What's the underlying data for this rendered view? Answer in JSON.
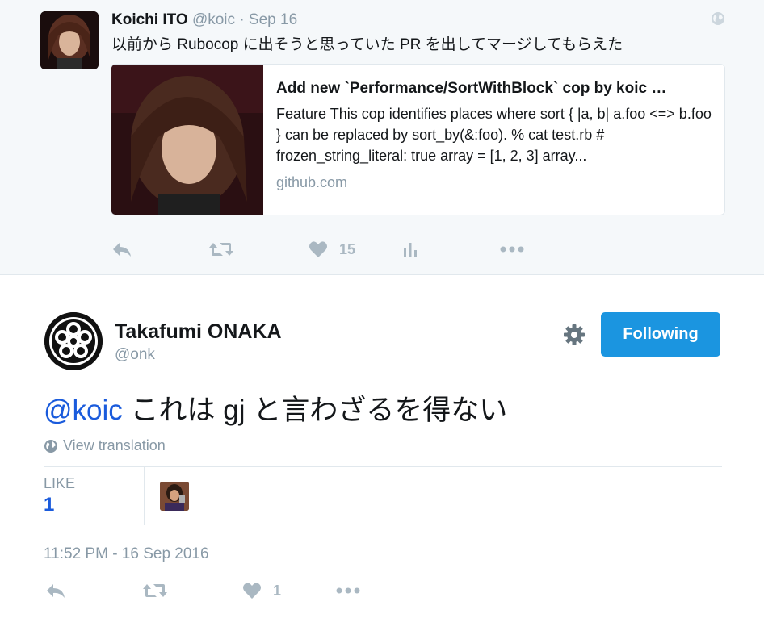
{
  "parent_tweet": {
    "name": "Koichi ITO",
    "handle": "@koic",
    "separator": "·",
    "date": "Sep 16",
    "text": "以前から Rubocop に出そうと思っていた PR を出してマージしてもらえた",
    "card": {
      "title": "Add new `Performance/SortWithBlock` cop by koic …",
      "description": "Feature This cop identifies places where sort { |a, b| a.foo <=> b.foo } can be replaced by sort_by(&:foo). % cat test.rb # frozen_string_literal: true array = [1, 2, 3] array...",
      "domain": "github.com"
    },
    "actions": {
      "reply_icon": "reply-icon",
      "retweet_icon": "retweet-icon",
      "like_icon": "heart-icon",
      "like_count": "15",
      "analytics_icon": "analytics-icon",
      "more_icon": "more-icon"
    }
  },
  "main_tweet": {
    "name": "Takafumi ONAKA",
    "handle": "@onk",
    "follow_label": "Following",
    "settings_icon": "gear-icon",
    "mention": "@koic",
    "text": " これは gj と言わざるを得ない",
    "translate_label": "View translation",
    "stats": {
      "like_label": "LIKE",
      "like_count": "1"
    },
    "timestamp": "11:52 PM - 16 Sep 2016",
    "actions": {
      "like_count": "1"
    }
  },
  "colors": {
    "accent": "#1b95e0",
    "mention": "#1a5bdc",
    "muted": "#8899a6",
    "icon": "#aab8c2",
    "parent_bg": "#f5f8fa"
  }
}
